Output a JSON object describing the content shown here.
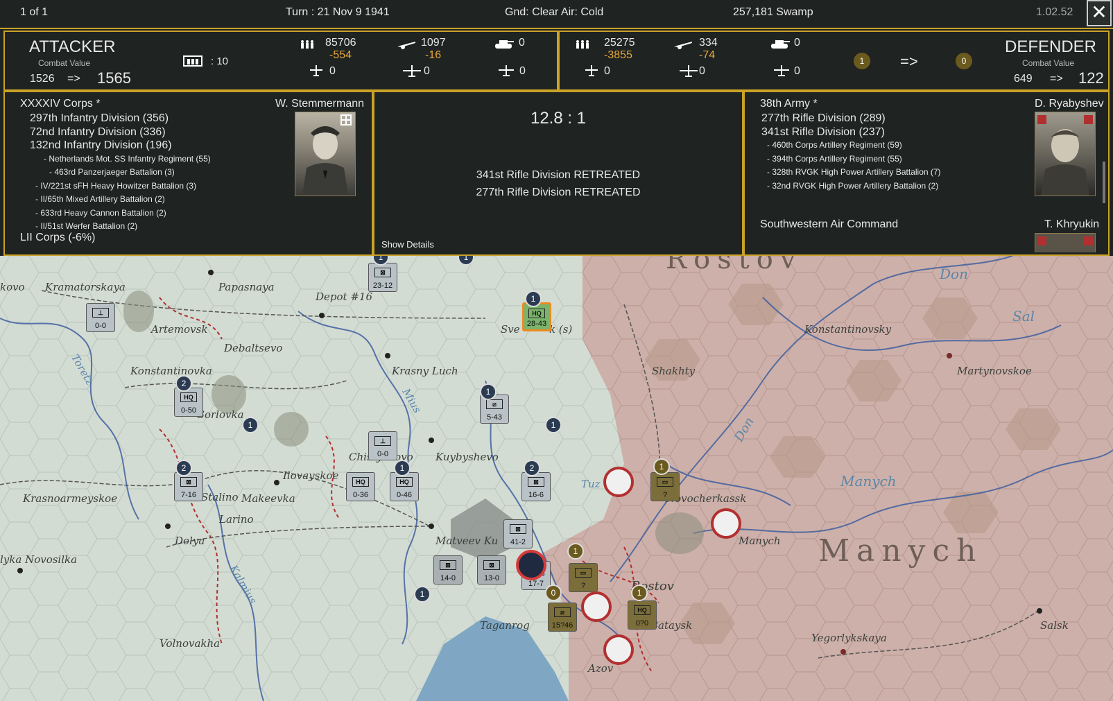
{
  "topbar": {
    "page": "1 of 1",
    "turn": "Turn : 21   Nov 9 1941",
    "weather": "Gnd: Clear  Air: Cold",
    "location": "257,181   Swamp",
    "version": "1.02.52",
    "close_glyph": "✕"
  },
  "attacker": {
    "title": "ATTACKER",
    "cv_label": "Combat Value",
    "cv_before": "1526",
    "arrow": "=>",
    "cv_after": "1565",
    "fort_value": ": 10",
    "men": "85706",
    "men_loss": "-554",
    "guns": "1097",
    "guns_loss": "-16",
    "afv": "0",
    "air1": "0",
    "air2": "0",
    "air3": "0"
  },
  "defender": {
    "title": "DEFENDER",
    "cv_label": "Combat Value",
    "cv_before": "649",
    "arrow": "=>",
    "cv_after": "122",
    "men": "25275",
    "men_loss": "-3855",
    "guns": "334",
    "guns_loss": "-74",
    "afv": "0",
    "air1": "0",
    "air2": "0",
    "air3": "0"
  },
  "morale": {
    "left": "1",
    "arrow": "=>",
    "right": "0"
  },
  "attacker_units": {
    "corps": "XXXXIV Corps *",
    "commander": "W. Stemmermann",
    "lines": [
      {
        "t": "297th Infantry Division (356)",
        "lvl": 1
      },
      {
        "t": "72nd Infantry Division (336)",
        "lvl": 1
      },
      {
        "t": "132nd Infantry Division (196)",
        "lvl": 1
      },
      {
        "t": "- Netherlands Mot. SS Infantry Regiment (55)",
        "lvl": 3
      },
      {
        "t": "- 463rd Panzerjaeger Battalion (3)",
        "lvl": 4
      },
      {
        "t": "- IV/221st sFH Heavy Howitzer Battalion (3)",
        "lvl": 2
      },
      {
        "t": "- II/65th Mixed Artillery Battalion (2)",
        "lvl": 2
      },
      {
        "t": "- 633rd Heavy Cannon Battalion (2)",
        "lvl": 2
      },
      {
        "t": "- II/51st Werfer Battalion (2)",
        "lvl": 2
      }
    ],
    "next_corps": "LII Corps (-6%)"
  },
  "result": {
    "ratio": "12.8 : 1",
    "line1": "341st Rifle Division RETREATED",
    "line2": "277th Rifle Division RETREATED",
    "show_details": "Show Details"
  },
  "defender_units": {
    "army": "38th Army *",
    "commander": "D. Ryabyshev",
    "lines": [
      {
        "t": "277th Rifle Division (289)",
        "lvl": 1
      },
      {
        "t": "341st Rifle Division (237)",
        "lvl": 1
      },
      {
        "t": "- 460th Corps Artillery Regiment (59)",
        "lvl": 2
      },
      {
        "t": "- 394th Corps Artillery Regiment (55)",
        "lvl": 2
      },
      {
        "t": "- 328th RVGK High Power Artillery Battalion (7)",
        "lvl": 2
      },
      {
        "t": "- 32nd RVGK High Power Artillery Battalion (2)",
        "lvl": 2
      }
    ],
    "air_command": "Southwestern Air Command",
    "air_commander": "T. Khryukin"
  },
  "map": {
    "towns": [
      "kovo",
      "Kramatorskaya",
      "Papasnaya",
      "Depot #16",
      "Artemovsk",
      "Sve",
      "k (s)",
      "Debaltsevo",
      "Konstantinovka",
      "Krasny Luch",
      "Gorlovka",
      "Mius",
      "Shakhty",
      "Konstantinovsky",
      "Martynovskoe",
      "Chistyakovo",
      "Kuybyshevo",
      "Ilovayskoe",
      "Krasnoarmeyskoe",
      "Stalino",
      "Makeevka",
      "Tuz",
      "Novocherkassk",
      "Larino",
      "Dolya",
      "Matveev Ku",
      "Manych",
      "lyka Novosilka",
      "Rostov",
      "Taganrog",
      "Bataysk",
      "Salsk",
      "Yegorlykskaya",
      "Volnovakha",
      "Azov",
      "Toretz",
      "Kalmius"
    ],
    "regions": [
      "Rostov",
      "Manych"
    ],
    "rivers": [
      "Don",
      "Sal",
      "Don",
      "Manych"
    ],
    "units": [
      {
        "str": "23-12",
        "sym": "⊠"
      },
      {
        "str": "28-43",
        "sym": "HQ"
      },
      {
        "str": "0-0",
        "sym": "⊥"
      },
      {
        "str": "0-50",
        "sym": "HQ"
      },
      {
        "str": "5-43",
        "sym": "⧄"
      },
      {
        "str": "0-0",
        "sym": "⊥"
      },
      {
        "str": "7-16",
        "sym": "⊠"
      },
      {
        "str": "0-36",
        "sym": "HQ"
      },
      {
        "str": "0-46",
        "sym": "HQ"
      },
      {
        "str": "16-6",
        "sym": "⊠"
      },
      {
        "str": "41-2",
        "sym": "⊠"
      },
      {
        "str": "14-0",
        "sym": "⊠"
      },
      {
        "str": "13-0",
        "sym": "⊠"
      },
      {
        "str": "17-7",
        "sym": "⊠"
      },
      {
        "str": "?",
        "sym": "▭"
      },
      {
        "str": "?",
        "sym": "▭"
      },
      {
        "str": "0?0",
        "sym": "HQ"
      },
      {
        "str": "15?46",
        "sym": "⧄"
      }
    ],
    "badges": [
      "1",
      "1",
      "1",
      "2",
      "1",
      "1",
      "1",
      "2",
      "1",
      "2",
      "1",
      "1",
      "0",
      "1",
      "1"
    ]
  },
  "colors": {
    "accent": "#c9a227",
    "panel_bg": "#1f2322",
    "loss": "#e8a93a",
    "german_land": "#cdd8cf",
    "soviet_land": "#c9a9a0"
  }
}
